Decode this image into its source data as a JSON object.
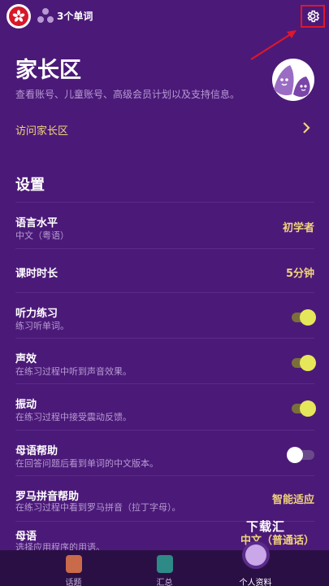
{
  "topbar": {
    "word_count": "3个单词"
  },
  "parent": {
    "title": "家长区",
    "description": "查看账号、儿童账号、高级会员计划以及支持信息。",
    "link_label": "访问家长区"
  },
  "settings": {
    "heading": "设置",
    "rows": [
      {
        "title": "语言水平",
        "subtitle": "中文（粤语）",
        "value": "初学者"
      },
      {
        "title": "课时时长",
        "subtitle": "",
        "value": "5分钟"
      },
      {
        "title": "听力练习",
        "subtitle": "练习听单词。",
        "toggle": true
      },
      {
        "title": "声效",
        "subtitle": "在练习过程中听到声音效果。",
        "toggle": true
      },
      {
        "title": "振动",
        "subtitle": "在练习过程中接受震动反馈。",
        "toggle": true
      },
      {
        "title": "母语帮助",
        "subtitle": "在回答问题后看到单词的中文版本。",
        "toggle": false
      },
      {
        "title": "罗马拼音帮助",
        "subtitle": "在练习过程中看到罗马拼音（拉丁字母）。",
        "value": "智能适应"
      },
      {
        "title": "母语",
        "subtitle": "选择应用程序的用语。",
        "value": "中文（普通话）"
      }
    ]
  },
  "nav": {
    "items": [
      {
        "label": "话题",
        "color": "#c96a4a"
      },
      {
        "label": "汇总",
        "color": "#2e8a86"
      },
      {
        "label": "个人资料",
        "color": "#c9a7e8"
      }
    ]
  },
  "watermark": "下载汇",
  "colors": {
    "background": "#4b1a78",
    "accent": "#f0d37a",
    "toggle_knob_on": "#e6e65a",
    "highlight_box": "#e0162b"
  }
}
